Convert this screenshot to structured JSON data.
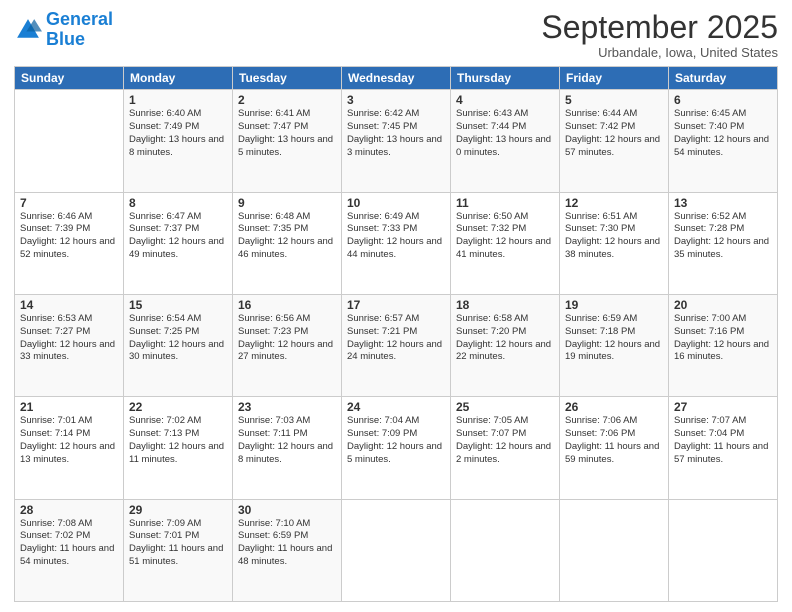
{
  "logo": {
    "line1": "General",
    "line2": "Blue"
  },
  "title": "September 2025",
  "location": "Urbandale, Iowa, United States",
  "days_header": [
    "Sunday",
    "Monday",
    "Tuesday",
    "Wednesday",
    "Thursday",
    "Friday",
    "Saturday"
  ],
  "weeks": [
    [
      {
        "day": "",
        "sunrise": "",
        "sunset": "",
        "daylight": ""
      },
      {
        "day": "1",
        "sunrise": "Sunrise: 6:40 AM",
        "sunset": "Sunset: 7:49 PM",
        "daylight": "Daylight: 13 hours and 8 minutes."
      },
      {
        "day": "2",
        "sunrise": "Sunrise: 6:41 AM",
        "sunset": "Sunset: 7:47 PM",
        "daylight": "Daylight: 13 hours and 5 minutes."
      },
      {
        "day": "3",
        "sunrise": "Sunrise: 6:42 AM",
        "sunset": "Sunset: 7:45 PM",
        "daylight": "Daylight: 13 hours and 3 minutes."
      },
      {
        "day": "4",
        "sunrise": "Sunrise: 6:43 AM",
        "sunset": "Sunset: 7:44 PM",
        "daylight": "Daylight: 13 hours and 0 minutes."
      },
      {
        "day": "5",
        "sunrise": "Sunrise: 6:44 AM",
        "sunset": "Sunset: 7:42 PM",
        "daylight": "Daylight: 12 hours and 57 minutes."
      },
      {
        "day": "6",
        "sunrise": "Sunrise: 6:45 AM",
        "sunset": "Sunset: 7:40 PM",
        "daylight": "Daylight: 12 hours and 54 minutes."
      }
    ],
    [
      {
        "day": "7",
        "sunrise": "Sunrise: 6:46 AM",
        "sunset": "Sunset: 7:39 PM",
        "daylight": "Daylight: 12 hours and 52 minutes."
      },
      {
        "day": "8",
        "sunrise": "Sunrise: 6:47 AM",
        "sunset": "Sunset: 7:37 PM",
        "daylight": "Daylight: 12 hours and 49 minutes."
      },
      {
        "day": "9",
        "sunrise": "Sunrise: 6:48 AM",
        "sunset": "Sunset: 7:35 PM",
        "daylight": "Daylight: 12 hours and 46 minutes."
      },
      {
        "day": "10",
        "sunrise": "Sunrise: 6:49 AM",
        "sunset": "Sunset: 7:33 PM",
        "daylight": "Daylight: 12 hours and 44 minutes."
      },
      {
        "day": "11",
        "sunrise": "Sunrise: 6:50 AM",
        "sunset": "Sunset: 7:32 PM",
        "daylight": "Daylight: 12 hours and 41 minutes."
      },
      {
        "day": "12",
        "sunrise": "Sunrise: 6:51 AM",
        "sunset": "Sunset: 7:30 PM",
        "daylight": "Daylight: 12 hours and 38 minutes."
      },
      {
        "day": "13",
        "sunrise": "Sunrise: 6:52 AM",
        "sunset": "Sunset: 7:28 PM",
        "daylight": "Daylight: 12 hours and 35 minutes."
      }
    ],
    [
      {
        "day": "14",
        "sunrise": "Sunrise: 6:53 AM",
        "sunset": "Sunset: 7:27 PM",
        "daylight": "Daylight: 12 hours and 33 minutes."
      },
      {
        "day": "15",
        "sunrise": "Sunrise: 6:54 AM",
        "sunset": "Sunset: 7:25 PM",
        "daylight": "Daylight: 12 hours and 30 minutes."
      },
      {
        "day": "16",
        "sunrise": "Sunrise: 6:56 AM",
        "sunset": "Sunset: 7:23 PM",
        "daylight": "Daylight: 12 hours and 27 minutes."
      },
      {
        "day": "17",
        "sunrise": "Sunrise: 6:57 AM",
        "sunset": "Sunset: 7:21 PM",
        "daylight": "Daylight: 12 hours and 24 minutes."
      },
      {
        "day": "18",
        "sunrise": "Sunrise: 6:58 AM",
        "sunset": "Sunset: 7:20 PM",
        "daylight": "Daylight: 12 hours and 22 minutes."
      },
      {
        "day": "19",
        "sunrise": "Sunrise: 6:59 AM",
        "sunset": "Sunset: 7:18 PM",
        "daylight": "Daylight: 12 hours and 19 minutes."
      },
      {
        "day": "20",
        "sunrise": "Sunrise: 7:00 AM",
        "sunset": "Sunset: 7:16 PM",
        "daylight": "Daylight: 12 hours and 16 minutes."
      }
    ],
    [
      {
        "day": "21",
        "sunrise": "Sunrise: 7:01 AM",
        "sunset": "Sunset: 7:14 PM",
        "daylight": "Daylight: 12 hours and 13 minutes."
      },
      {
        "day": "22",
        "sunrise": "Sunrise: 7:02 AM",
        "sunset": "Sunset: 7:13 PM",
        "daylight": "Daylight: 12 hours and 11 minutes."
      },
      {
        "day": "23",
        "sunrise": "Sunrise: 7:03 AM",
        "sunset": "Sunset: 7:11 PM",
        "daylight": "Daylight: 12 hours and 8 minutes."
      },
      {
        "day": "24",
        "sunrise": "Sunrise: 7:04 AM",
        "sunset": "Sunset: 7:09 PM",
        "daylight": "Daylight: 12 hours and 5 minutes."
      },
      {
        "day": "25",
        "sunrise": "Sunrise: 7:05 AM",
        "sunset": "Sunset: 7:07 PM",
        "daylight": "Daylight: 12 hours and 2 minutes."
      },
      {
        "day": "26",
        "sunrise": "Sunrise: 7:06 AM",
        "sunset": "Sunset: 7:06 PM",
        "daylight": "Daylight: 11 hours and 59 minutes."
      },
      {
        "day": "27",
        "sunrise": "Sunrise: 7:07 AM",
        "sunset": "Sunset: 7:04 PM",
        "daylight": "Daylight: 11 hours and 57 minutes."
      }
    ],
    [
      {
        "day": "28",
        "sunrise": "Sunrise: 7:08 AM",
        "sunset": "Sunset: 7:02 PM",
        "daylight": "Daylight: 11 hours and 54 minutes."
      },
      {
        "day": "29",
        "sunrise": "Sunrise: 7:09 AM",
        "sunset": "Sunset: 7:01 PM",
        "daylight": "Daylight: 11 hours and 51 minutes."
      },
      {
        "day": "30",
        "sunrise": "Sunrise: 7:10 AM",
        "sunset": "Sunset: 6:59 PM",
        "daylight": "Daylight: 11 hours and 48 minutes."
      },
      {
        "day": "",
        "sunrise": "",
        "sunset": "",
        "daylight": ""
      },
      {
        "day": "",
        "sunrise": "",
        "sunset": "",
        "daylight": ""
      },
      {
        "day": "",
        "sunrise": "",
        "sunset": "",
        "daylight": ""
      },
      {
        "day": "",
        "sunrise": "",
        "sunset": "",
        "daylight": ""
      }
    ]
  ]
}
